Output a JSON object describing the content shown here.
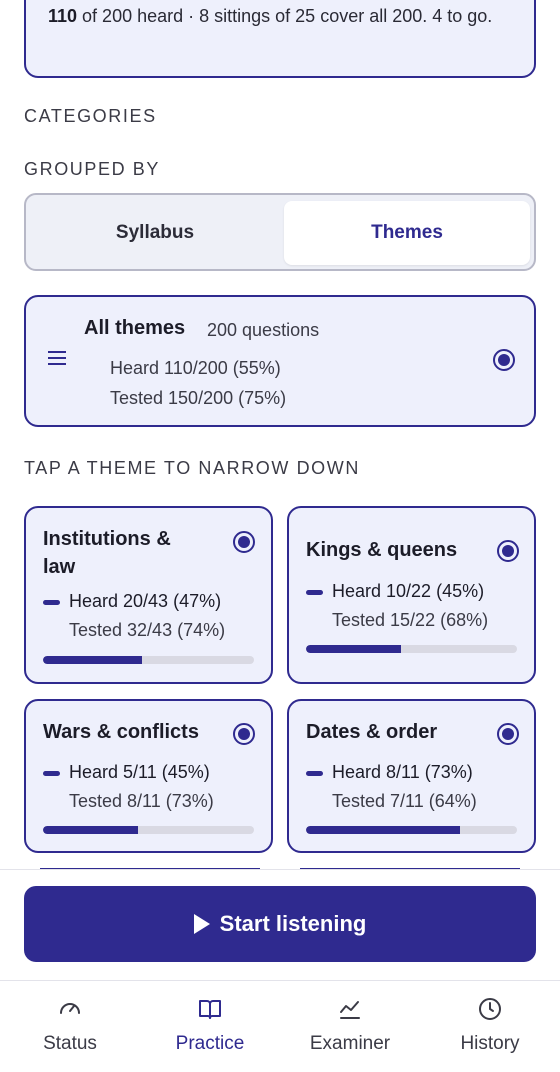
{
  "summary": {
    "heard_bold": "110",
    "text_rest": " of 200 heard · 8 sittings of 25 cover all 200. 4 to go."
  },
  "categories_label": "CATEGORIES",
  "grouped_by_label": "GROUPED BY",
  "grouping": {
    "options": [
      "Syllabus",
      "Themes"
    ],
    "selected": "Themes"
  },
  "all_themes": {
    "title": "All themes",
    "count": "200 questions",
    "heard": "Heard 110/200 (55%)",
    "tested": "Tested 150/200 (75%)",
    "selected": true
  },
  "narrow_label": "TAP A THEME TO NARROW DOWN",
  "themes": [
    {
      "title_line1": "Institutions &",
      "title_line2": "law",
      "heard": "Heard 20/43 (47%)",
      "tested": "Tested 32/43 (74%)",
      "progress": 0.47,
      "selected": true
    },
    {
      "title_line1": "Kings & queens",
      "title_line2": "",
      "heard": "Heard 10/22 (45%)",
      "tested": "Tested 15/22 (68%)",
      "progress": 0.45,
      "selected": true
    },
    {
      "title_line1": "Wars & conflicts",
      "title_line2": "",
      "heard": "Heard 5/11 (45%)",
      "tested": "Tested 8/11 (73%)",
      "progress": 0.45,
      "selected": true
    },
    {
      "title_line1": "Dates & order",
      "title_line2": "",
      "heard": "Heard 8/11 (73%)",
      "tested": "Tested 7/11 (64%)",
      "progress": 0.73,
      "selected": true
    }
  ],
  "start_button": "Start listening",
  "tabs": [
    {
      "label": "Status",
      "icon": "gauge-icon",
      "active": false
    },
    {
      "label": "Practice",
      "icon": "book-icon",
      "active": true
    },
    {
      "label": "Examiner",
      "icon": "chart-line-icon",
      "active": false
    },
    {
      "label": "History",
      "icon": "clock-icon",
      "active": false
    }
  ],
  "colors": {
    "accent": "#2f2a8f",
    "card_bg": "#eef0fc",
    "track": "#d9d9e3"
  }
}
